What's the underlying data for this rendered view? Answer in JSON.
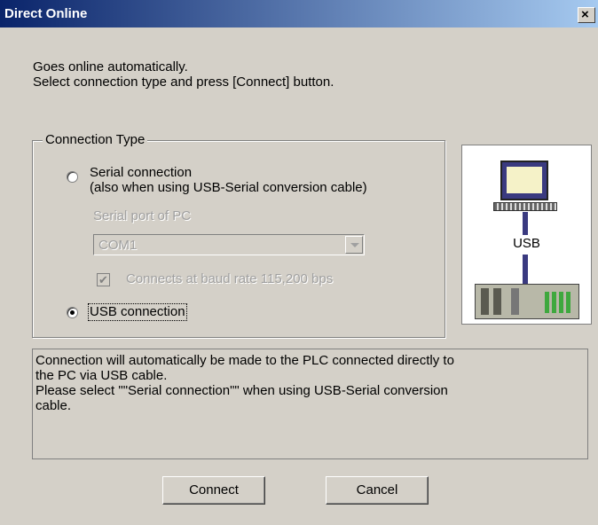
{
  "window": {
    "title": "Direct Online",
    "close_label": "×"
  },
  "intro": {
    "line1": "Goes online automatically.",
    "line2": "Select connection type and press [Connect] button."
  },
  "connection_type": {
    "group_title": "Connection Type",
    "serial": {
      "label_line1": "Serial connection",
      "label_line2": "(also when using USB-Serial conversion cable)",
      "selected": false
    },
    "serial_port_label": "Serial port of PC",
    "serial_port_value": "COM1",
    "baud_label": "Connects at baud rate 115,200 bps",
    "baud_checked": true,
    "usb": {
      "label": "USB connection",
      "selected": true
    }
  },
  "diagram": {
    "usb_label": "USB"
  },
  "description": {
    "line1": "Connection will automatically be made to the PLC connected directly to",
    "line2": "the PC via USB cable.",
    "line3": "Please select \"\"Serial connection\"\" when using USB-Serial conversion",
    "line4": "cable."
  },
  "buttons": {
    "connect": "Connect",
    "cancel": "Cancel"
  }
}
